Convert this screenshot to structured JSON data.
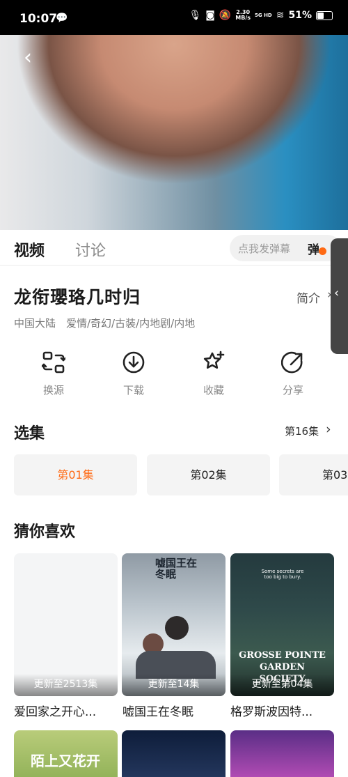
{
  "status": {
    "time": "10:07",
    "speed_top": "2.30",
    "speed_bottom": "MB/s",
    "network": "5G HD",
    "battery": "51%",
    "battery_level": 0.51
  },
  "tabs": {
    "video": "视频",
    "discussion": "讨论"
  },
  "danmu": {
    "placeholder": "点我发弹幕",
    "button": "弹"
  },
  "show": {
    "title": "龙衔瓔珞几时归",
    "intro": "简介",
    "intro_arrow": "›",
    "region": "中国大陆",
    "genres": "爱情/奇幻/古装/内地剧/内地"
  },
  "actions": [
    {
      "label": "换源",
      "icon": "switch-source-icon"
    },
    {
      "label": "下载",
      "icon": "download-icon"
    },
    {
      "label": "收藏",
      "icon": "favorite-star-icon"
    },
    {
      "label": "分享",
      "icon": "share-icon"
    }
  ],
  "episodes": {
    "heading": "选集",
    "more": "第16集",
    "more_arrow": "›",
    "items": [
      "第01集",
      "第02集",
      "第03"
    ],
    "selected_index": 0
  },
  "recommend": {
    "heading": "猜你喜欢",
    "items": [
      {
        "title": "爱回家之开心...",
        "badge": "更新至2513集"
      },
      {
        "title": "嘘国王在冬眠",
        "badge": "更新至14集",
        "poster_text": "嘘国王在冬眠"
      },
      {
        "title": "格罗斯波因特...",
        "badge": "更新至第04集",
        "poster_text": "GROSSE POINTE GARDEN SOCIETY",
        "poster_sub": "Some secrets are too big to bury."
      }
    ],
    "row2_poster_text": "陌上又花开"
  },
  "colors": {
    "accent": "#ff6a14",
    "text": "#1a1a1a",
    "muted": "#888888"
  }
}
